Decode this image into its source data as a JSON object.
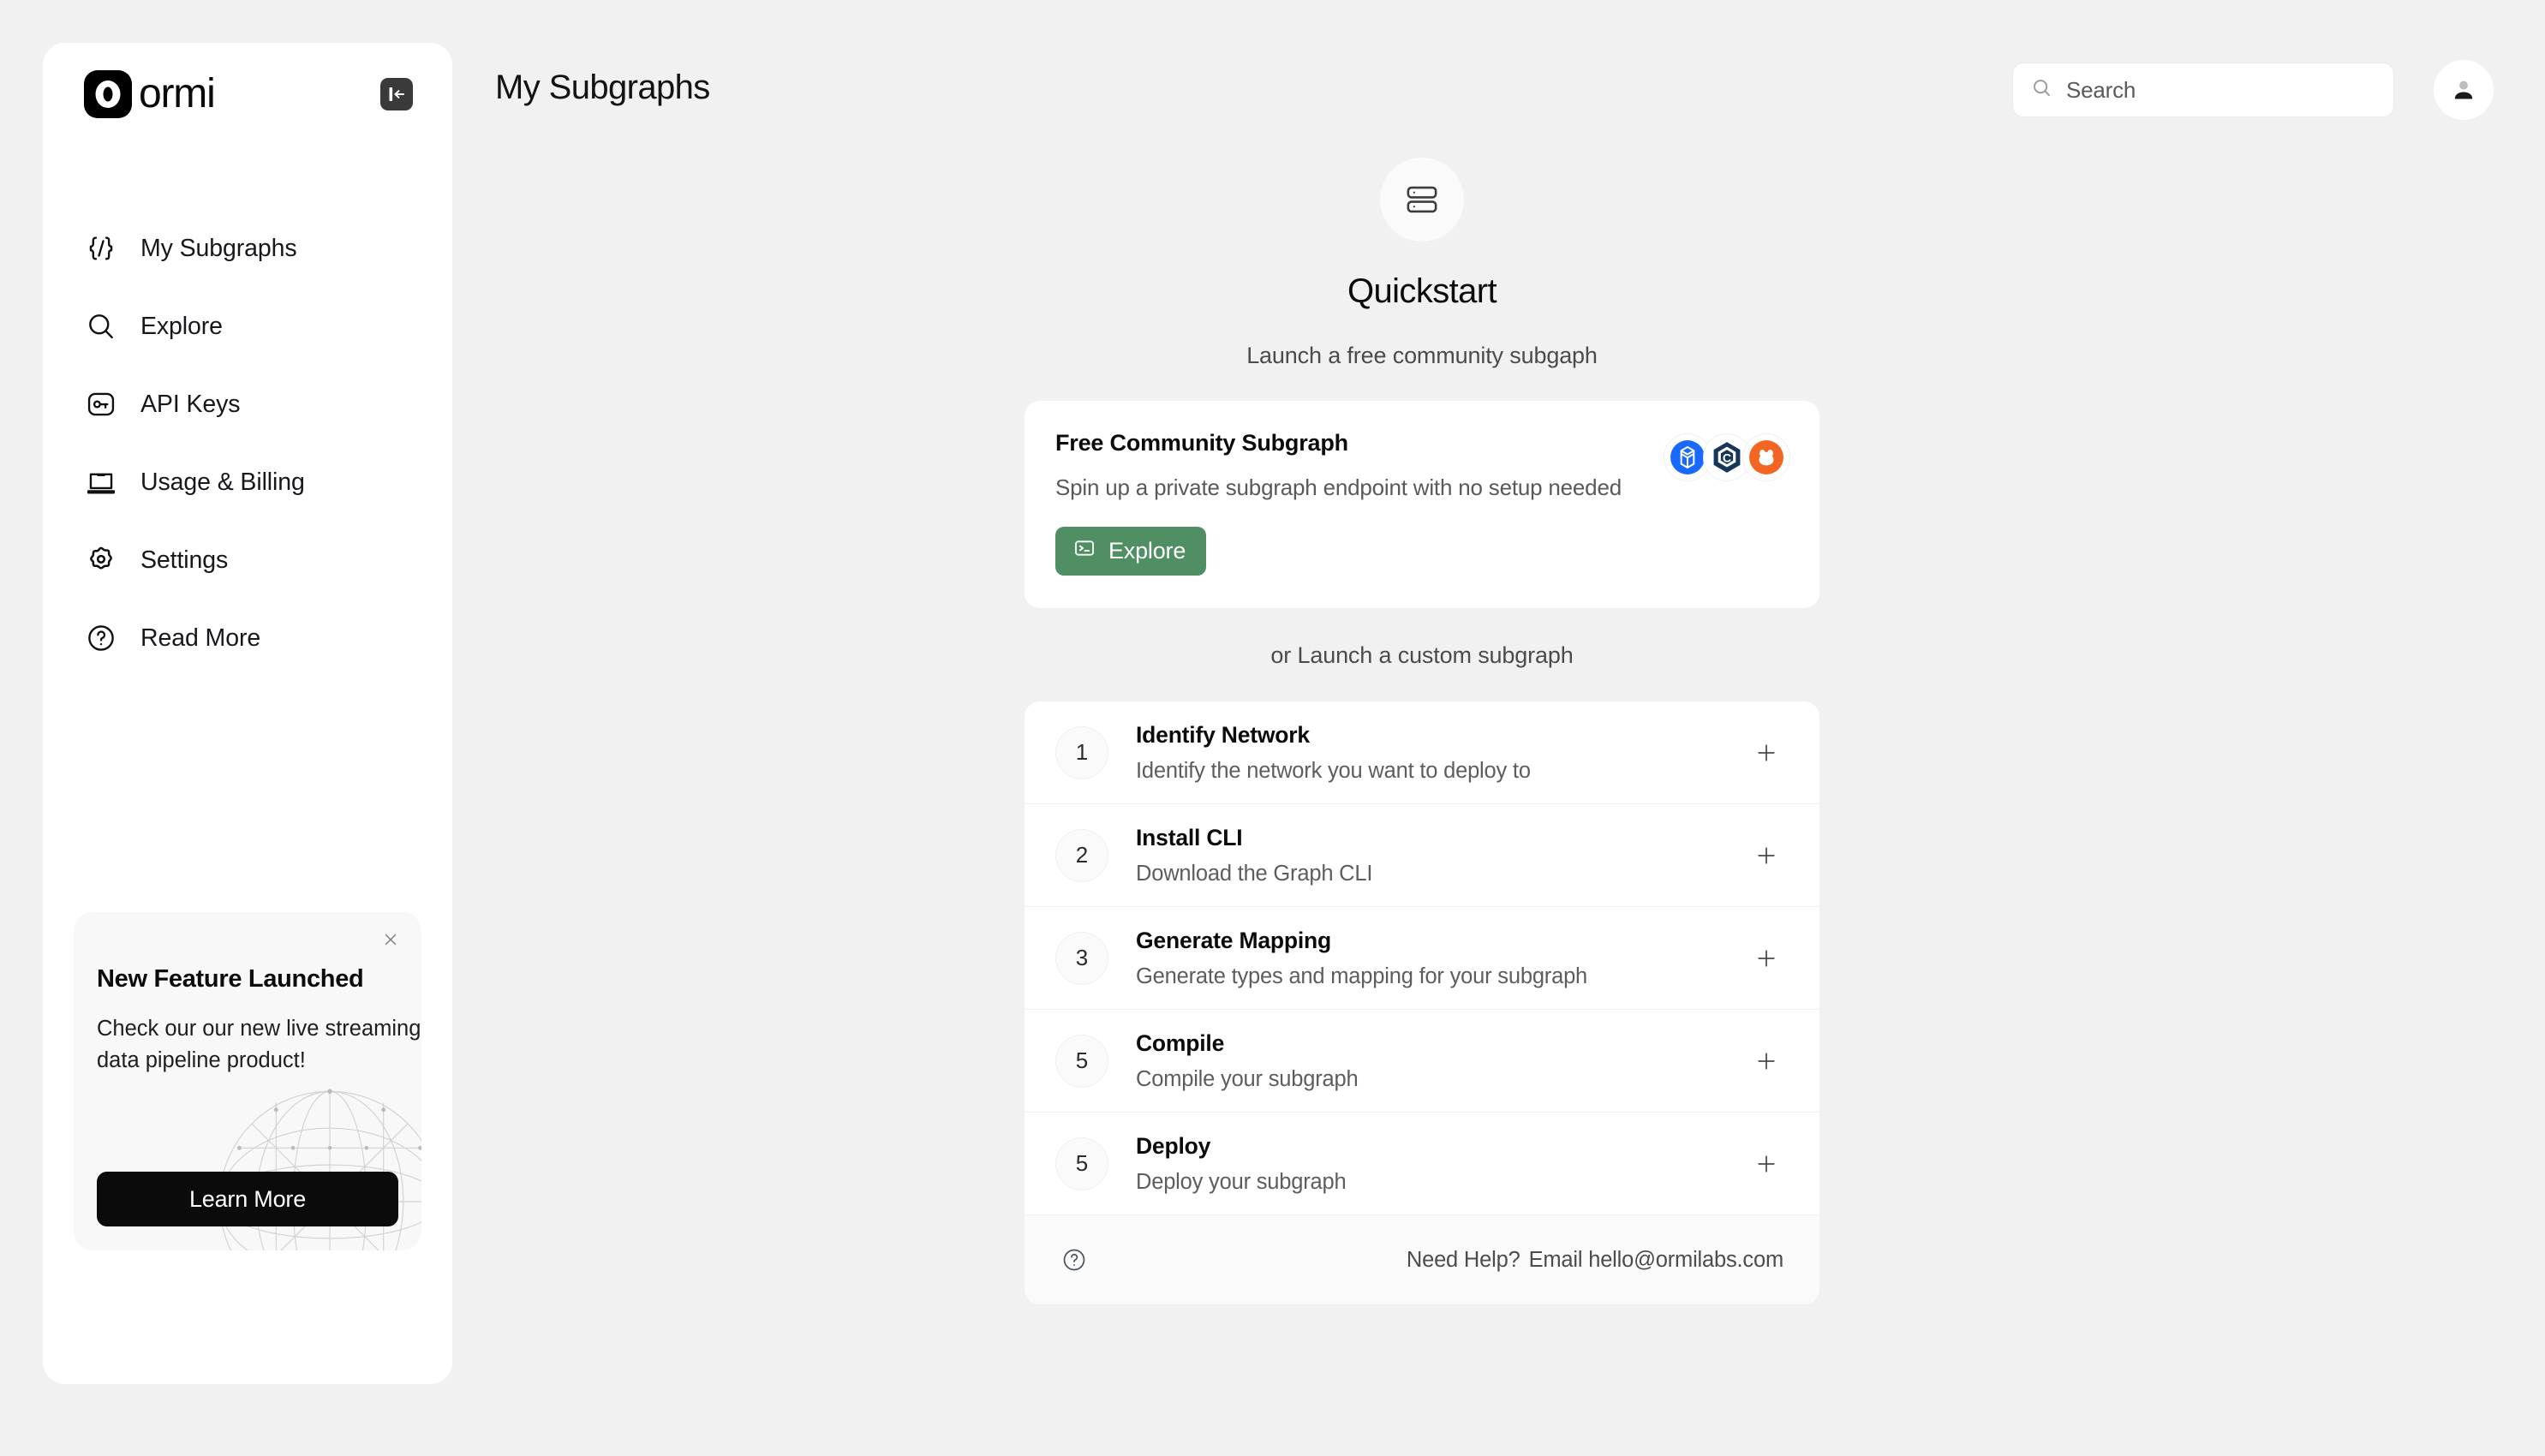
{
  "brand": {
    "logo_text": "ormi",
    "logo_mark_char": "0"
  },
  "sidebar": {
    "collapse_label": "Collapse sidebar",
    "items": [
      {
        "label": "My Subgraphs",
        "icon": "code-braces-icon"
      },
      {
        "label": "Explore",
        "icon": "search-icon"
      },
      {
        "label": "API Keys",
        "icon": "key-icon"
      },
      {
        "label": "Usage & Billing",
        "icon": "laptop-icon"
      },
      {
        "label": "Settings",
        "icon": "gear-icon"
      },
      {
        "label": "Read More",
        "icon": "question-circle-icon"
      }
    ],
    "promo": {
      "title": "New Feature Launched",
      "body": "Check our our new live streaming data pipeline product!",
      "button": "Learn More",
      "close_label": "Dismiss"
    }
  },
  "header": {
    "title": "My Subgraphs",
    "search_placeholder": "Search",
    "search_value": "",
    "avatar_label": "Account"
  },
  "main": {
    "quickstart_title": "Quickstart",
    "quickstart_subtitle": "Launch a free community subgaph",
    "free_card": {
      "title": "Free  Community Subgraph",
      "description": "Spin up a private subgraph endpoint with no setup needed",
      "button": "Explore",
      "chains": [
        "fantom-chain-icon",
        "cronos-chain-icon",
        "berachain-chain-icon"
      ]
    },
    "or_label": "or Launch a custom subgraph",
    "steps": [
      {
        "num": "1",
        "title": "Identify Network",
        "desc": "Identify the network you want to deploy to"
      },
      {
        "num": "2",
        "title": "Install CLI",
        "desc": "Download the Graph CLI"
      },
      {
        "num": "3",
        "title": "Generate Mapping",
        "desc": "Generate types and mapping for your subgraph"
      },
      {
        "num": "5",
        "title": "Compile",
        "desc": "Compile your subgraph"
      },
      {
        "num": "5",
        "title": "Deploy",
        "desc": "Deploy your subgraph"
      }
    ],
    "help": {
      "question": "Need Help?",
      "email": "Email hello@ormilabs.com"
    }
  },
  "colors": {
    "page_bg": "#f1f1f1",
    "card_bg": "#ffffff",
    "accent_green": "#4f8f63",
    "promo_button": "#0b0b0b",
    "fantom_blue": "#1969ff",
    "cronos_navy": "#17365c",
    "bera_orange": "#f26522"
  }
}
